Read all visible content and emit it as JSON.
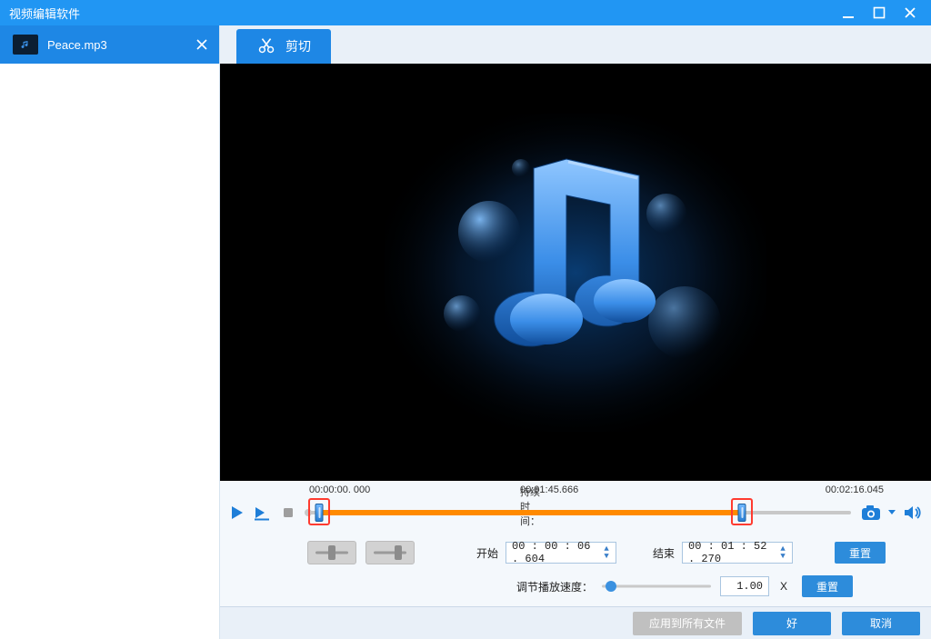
{
  "app": {
    "title": "视频编辑软件"
  },
  "sidebar": {
    "file": {
      "name": "Peace.mp3"
    }
  },
  "toolbar": {
    "cut_label": "剪切"
  },
  "timeline": {
    "position_label": "00:00:00. 000",
    "duration_label_prefix": "持续时间：",
    "duration_value": "00:01:45.666",
    "total_label": "00:02:16.045"
  },
  "editor": {
    "start_label": "开始",
    "start_value": "00 : 00 : 06 . 604",
    "end_label": "结束",
    "end_value": "00 : 01 : 52 . 270",
    "reset_label": "重置",
    "speed_label": "调节播放速度：",
    "speed_value": "1.00",
    "speed_unit": "X"
  },
  "footer": {
    "apply_all": "应用到所有文件",
    "ok": "好",
    "cancel": "取消"
  }
}
